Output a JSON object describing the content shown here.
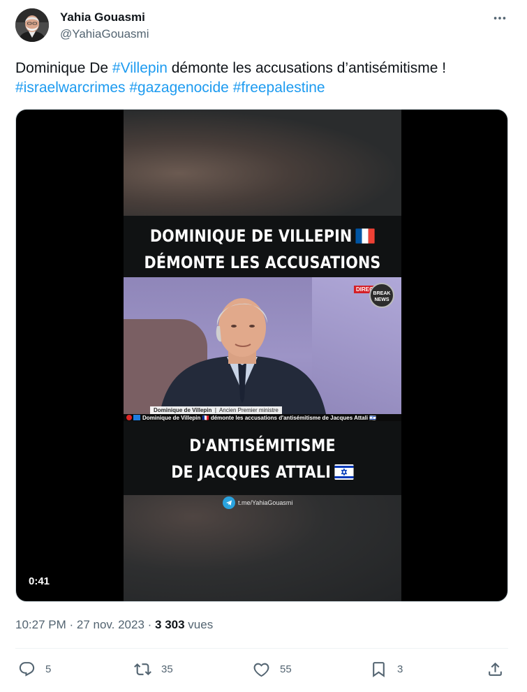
{
  "author": {
    "name": "Yahia Gouasmi",
    "handle": "@YahiaGouasmi"
  },
  "tweet": {
    "text_before_link": "Dominique De ",
    "mention_link": "#Villepin",
    "text_after_link": " démonte les accusations d’antisémitisme !",
    "hashtags": [
      "#israelwarcrimes",
      "#gazagenocide",
      "#freepalestine"
    ]
  },
  "video": {
    "caption_top": [
      "DOMINIQUE DE VILLEPIN",
      "DÉMONTE LES ACCUSATIONS"
    ],
    "caption_bottom": [
      "D'ANTISÉMITISME",
      "DE JACQUES ATTALI"
    ],
    "live_badge": "DIRECT",
    "channel_logo": [
      "BREAK",
      "NEWS"
    ],
    "lower_third_name": "Dominique de Villepin",
    "lower_third_role": "Ancien Premier ministre",
    "ticker_text": "Dominique de Villepin 🇫🇷 démonte les accusations d'antisémitisme de Jacques Attali 🇮🇱",
    "telegram_link": "t.me/YahiaGouasmi",
    "duration": "0:41"
  },
  "meta": {
    "time": "10:27 PM",
    "separator": " · ",
    "date": "27 nov. 2023",
    "views_count": "3 303",
    "views_label": " vues"
  },
  "actions": {
    "replies": "5",
    "retweets": "35",
    "likes": "55",
    "bookmarks": "3"
  },
  "colors": {
    "link": "#1d9bf0",
    "secondary_text": "#536471",
    "primary_text": "#0f1419"
  }
}
